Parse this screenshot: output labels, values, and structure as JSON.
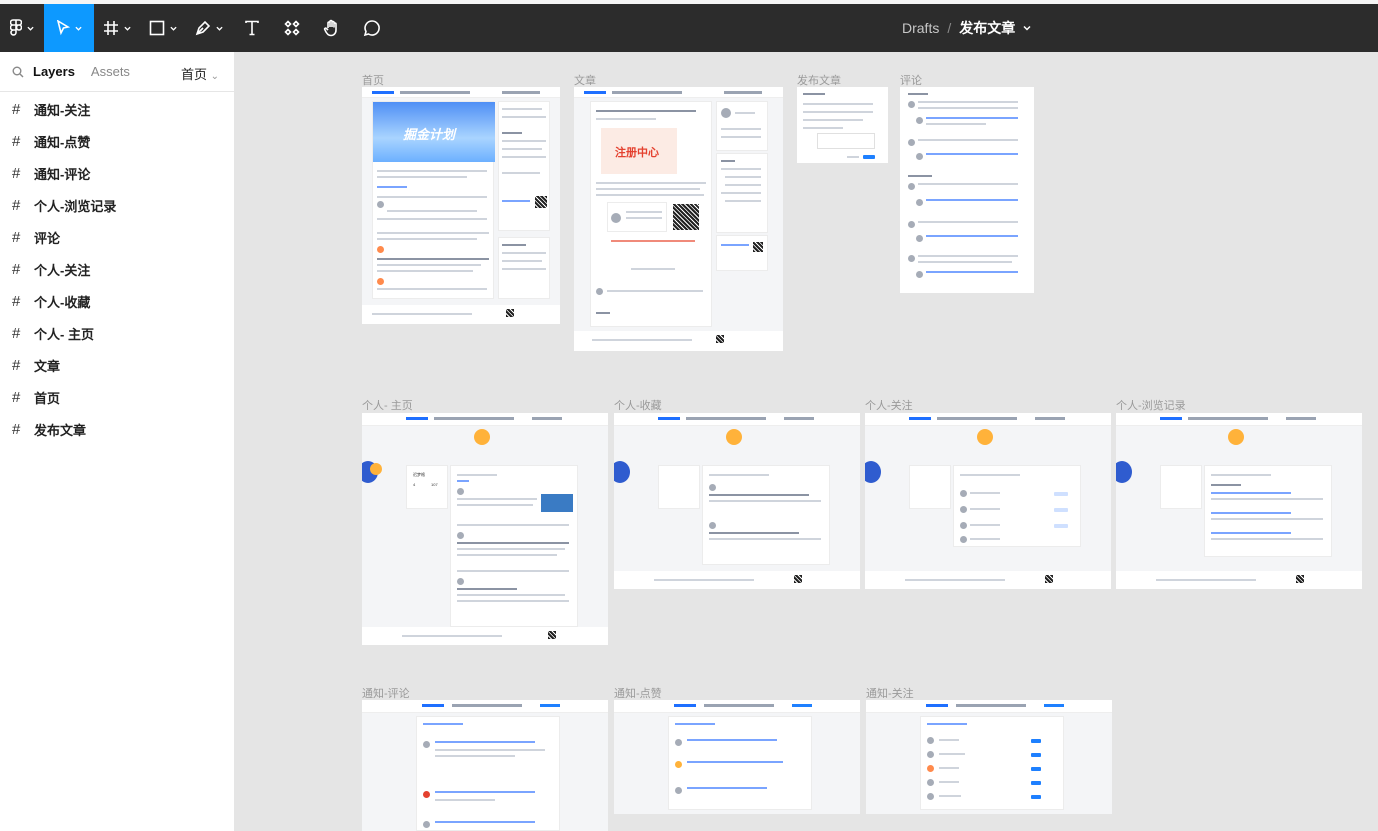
{
  "toolbar": {
    "tools": [
      "figma-menu",
      "move",
      "frame",
      "shape",
      "pen",
      "text",
      "resources",
      "hand",
      "comment"
    ],
    "active_tool": "move",
    "breadcrumb": {
      "project": "Drafts",
      "separator": "/",
      "file": "发布文章"
    }
  },
  "sidebar": {
    "tabs": [
      "Layers",
      "Assets"
    ],
    "active_tab": "Layers",
    "current_page": "首页",
    "layers": [
      "通知-关注",
      "通知-点赞",
      "通知-评论",
      "个人-浏览记录",
      "评论",
      "个人-关注",
      "个人-收藏",
      "个人- 主页",
      "文章",
      "首页",
      "发布文章"
    ]
  },
  "canvas": {
    "frames": [
      {
        "label": "首页"
      },
      {
        "label": "文章"
      },
      {
        "label": "发布文章"
      },
      {
        "label": "评论"
      },
      {
        "label": "个人- 主页"
      },
      {
        "label": "个人-收藏"
      },
      {
        "label": "个人-关注"
      },
      {
        "label": "个人-浏览记录"
      },
      {
        "label": "通知-评论"
      },
      {
        "label": "通知-点赞"
      },
      {
        "label": "通知-关注"
      }
    ],
    "home_banner_text": "掘金计划",
    "article_banner_text": "注册中心",
    "profile_username": "迟梦格",
    "profile_stats": [
      "4",
      "107"
    ]
  },
  "colors": {
    "toolbar_bg": "#2c2c2c",
    "accent": "#0d99ff",
    "canvas_bg": "#e5e5e5",
    "brand_blue": "#1e80ff"
  }
}
